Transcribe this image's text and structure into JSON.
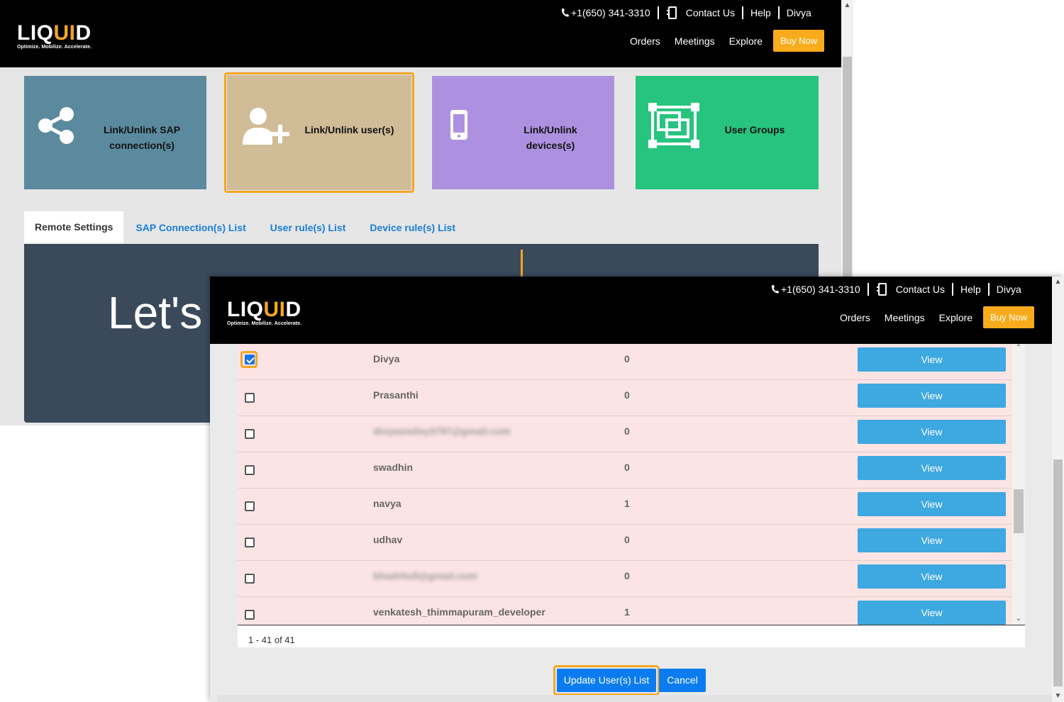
{
  "brand": {
    "word_pre": "LIQ",
    "word_accent": "UI",
    "word_post": "D",
    "tagline": "Optimize. Mobilize. Accelerate."
  },
  "header": {
    "phone": "+1(650) 341-3310",
    "contact": "Contact Us",
    "help": "Help",
    "user": "Divya",
    "nav": {
      "orders": "Orders",
      "meetings": "Meetings",
      "explore": "Explore",
      "buy": "Buy Now"
    }
  },
  "tiles": [
    {
      "line1": "Link/Unlink SAP",
      "line2": "connection(s)",
      "color": "#5b8a9e",
      "icon": "share-icon"
    },
    {
      "line1": "Link/Unlink user(s)",
      "line2": "",
      "color": "#d1bc98",
      "icon": "add-user-icon"
    },
    {
      "line1": "Link/Unlink",
      "line2": "devices(s)",
      "color": "#ad91e0",
      "icon": "mobile-icon"
    },
    {
      "line1": "User Groups",
      "line2": "",
      "color": "#27c47f",
      "icon": "group-frame-icon"
    }
  ],
  "tabs": {
    "remote": "Remote Settings",
    "sap": "SAP Connection(s) List",
    "user": "User rule(s) List",
    "device": "Device rule(s) List"
  },
  "hero": {
    "text": "Let's"
  },
  "users": [
    {
      "name": "Divya",
      "count": "0",
      "view": "View",
      "checked": true
    },
    {
      "name": "Prasanthi",
      "count": "0",
      "view": "View",
      "checked": false
    },
    {
      "name": "divyasmiley3797@gmail.com",
      "count": "0",
      "view": "View",
      "checked": false,
      "blurred": true
    },
    {
      "name": "swadhin",
      "count": "0",
      "view": "View",
      "checked": false
    },
    {
      "name": "navya",
      "count": "1",
      "view": "View",
      "checked": false
    },
    {
      "name": "udhav",
      "count": "0",
      "view": "View",
      "checked": false
    },
    {
      "name": "bhadritull@gmail.com",
      "count": "0",
      "view": "View",
      "checked": false,
      "blurred": true
    },
    {
      "name": "venkatesh_thimmapuram_developer",
      "count": "1",
      "view": "View",
      "checked": false
    }
  ],
  "pager": "1 - 41 of 41",
  "actions": {
    "update": "Update User(s) List",
    "cancel": "Cancel"
  },
  "colors": {
    "accent": "#f5a623",
    "primary": "#0b7cf0",
    "view": "#3ea8e0",
    "row_bg": "#fce4e4"
  }
}
